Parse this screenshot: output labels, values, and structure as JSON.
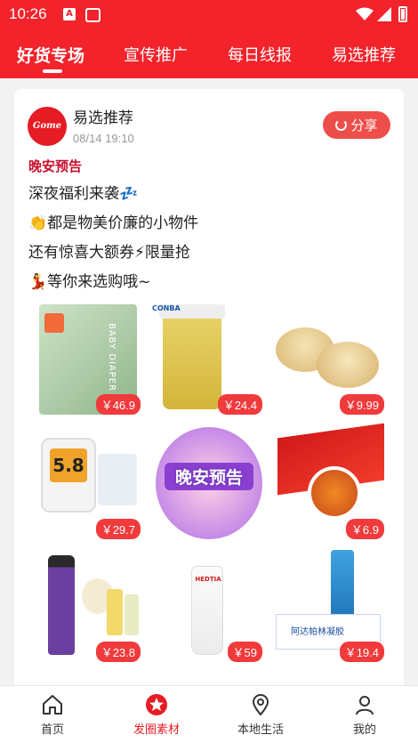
{
  "status_bar": {
    "time": "10:26",
    "icons": [
      "a-icon",
      "bag-icon",
      "wifi-icon",
      "signal-icon",
      "battery-icon"
    ]
  },
  "tabs": [
    {
      "label": "好货专场",
      "active": true
    },
    {
      "label": "宣传推广",
      "active": false
    },
    {
      "label": "每日线报",
      "active": false
    },
    {
      "label": "易选推荐",
      "active": false
    }
  ],
  "post": {
    "publisher": "易选推荐",
    "avatar_text": "Gome",
    "date": "08/14 19:10",
    "share_label": "分享",
    "title": "晚安预告",
    "lines": [
      "深夜福利来袭💤",
      "👏都是物美价廉的小物件",
      "还有惊喜大额券⚡限量抢",
      "💃等你来选购哦~"
    ],
    "products": [
      {
        "name": "diaper-pack",
        "price": "￥46.9",
        "brand_text": "BABY DIAPER"
      },
      {
        "name": "vitamin-capsules-bottle",
        "price": "￥24.4",
        "brand_text": "CONBA"
      },
      {
        "name": "pastry-cakes",
        "price": "￥9.99"
      },
      {
        "name": "glucose-meter",
        "price": "￥29.7",
        "display_text": "5.8"
      },
      {
        "name": "good-night-poster",
        "price": "",
        "poster_text": "晚安预告"
      },
      {
        "name": "chili-seasoning-packs",
        "price": "￥6.9"
      },
      {
        "name": "hair-care-set",
        "price": "￥23.8"
      },
      {
        "name": "face-cleanser-tube",
        "price": "￥59",
        "brand_text": "HEDTIA"
      },
      {
        "name": "ointment-tube",
        "price": "￥19.4",
        "box_text": "阿达帕林凝胶"
      }
    ]
  },
  "bottom_nav": [
    {
      "label": "首页",
      "icon": "home-icon",
      "active": false
    },
    {
      "label": "发圈素材",
      "icon": "star-badge-icon",
      "active": true
    },
    {
      "label": "本地生活",
      "icon": "location-icon",
      "active": false
    },
    {
      "label": "我的",
      "icon": "user-icon",
      "active": false
    }
  ],
  "colors": {
    "brand": "#f2232b",
    "price_bg": "#f03a3c",
    "title_red": "#c8102e"
  }
}
